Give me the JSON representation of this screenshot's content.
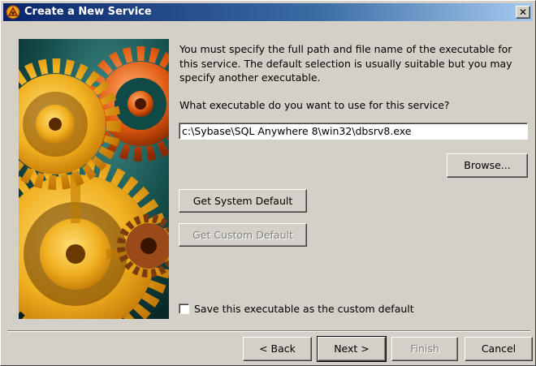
{
  "window": {
    "title": "Create a New Service",
    "close_label": "✕",
    "title_icon": "sybase-wizard-icon"
  },
  "main": {
    "description": "You must specify the full path and file name of the executable for this service. The default selection is usually suitable but you may specify another executable.",
    "question": "What executable do you want to use for this service?",
    "path_value": "c:\\Sybase\\SQL Anywhere 8\\win32\\dbsrv8.exe",
    "browse_label": "Browse...",
    "system_default_label": "Get System Default",
    "custom_default_label": "Get Custom Default",
    "custom_default_enabled": false,
    "save_checkbox_label": "Save this executable as the custom default",
    "save_checkbox_checked": false
  },
  "footer": {
    "back_label": "< Back",
    "next_label": "Next >",
    "finish_label": "Finish",
    "finish_enabled": false,
    "cancel_label": "Cancel"
  },
  "banner": {
    "image": "gears-illustration"
  },
  "colors": {
    "titlebar_start": "#0a246a",
    "titlebar_end": "#a6caf0",
    "face": "#d4d0c8",
    "disabled_text": "#808080"
  }
}
